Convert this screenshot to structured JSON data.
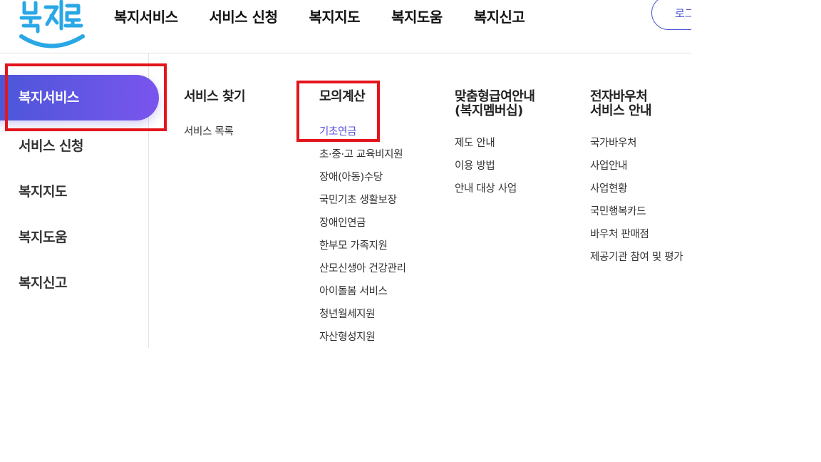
{
  "header": {
    "logo_text": "복지로",
    "nav": [
      "복지서비스",
      "서비스 신청",
      "복지지도",
      "복지도움",
      "복지신고"
    ],
    "login_label": "로그인"
  },
  "side_menu": {
    "active": "복지서비스",
    "items": [
      "서비스 신청",
      "복지지도",
      "복지도움",
      "복지신고"
    ]
  },
  "submenu": [
    {
      "title": "서비스 찾기",
      "links": [
        "서비스 목록"
      ]
    },
    {
      "title": "모의계산",
      "links": [
        "기초연금",
        "초·중·고 교육비지원",
        "장애(아동)수당",
        "국민기초 생활보장",
        "장애인연금",
        "한부모 가족지원",
        "산모신생아 건강관리",
        "아이돌봄 서비스",
        "청년월세지원",
        "자산형성지원"
      ],
      "active_link": "기초연금"
    },
    {
      "title_lines": [
        "맞춤형급여안내",
        "(복지멤버십)"
      ],
      "links": [
        "제도 안내",
        "이용 방법",
        "안내 대상 사업"
      ]
    },
    {
      "title_lines": [
        "전자바우처",
        "서비스 안내"
      ],
      "links": [
        "국가바우처",
        "사업안내",
        "사업현황",
        "국민행복카드",
        "바우처 판매점",
        "제공기관 참여 및 평가"
      ]
    }
  ],
  "colors": {
    "accent": "#4b55d6",
    "gradient_start": "#4a57d8",
    "gradient_end": "#7a55ee",
    "active_link": "#5a4fe0",
    "highlight": "#e3151c",
    "logo_blue": "#2aa7e6"
  }
}
